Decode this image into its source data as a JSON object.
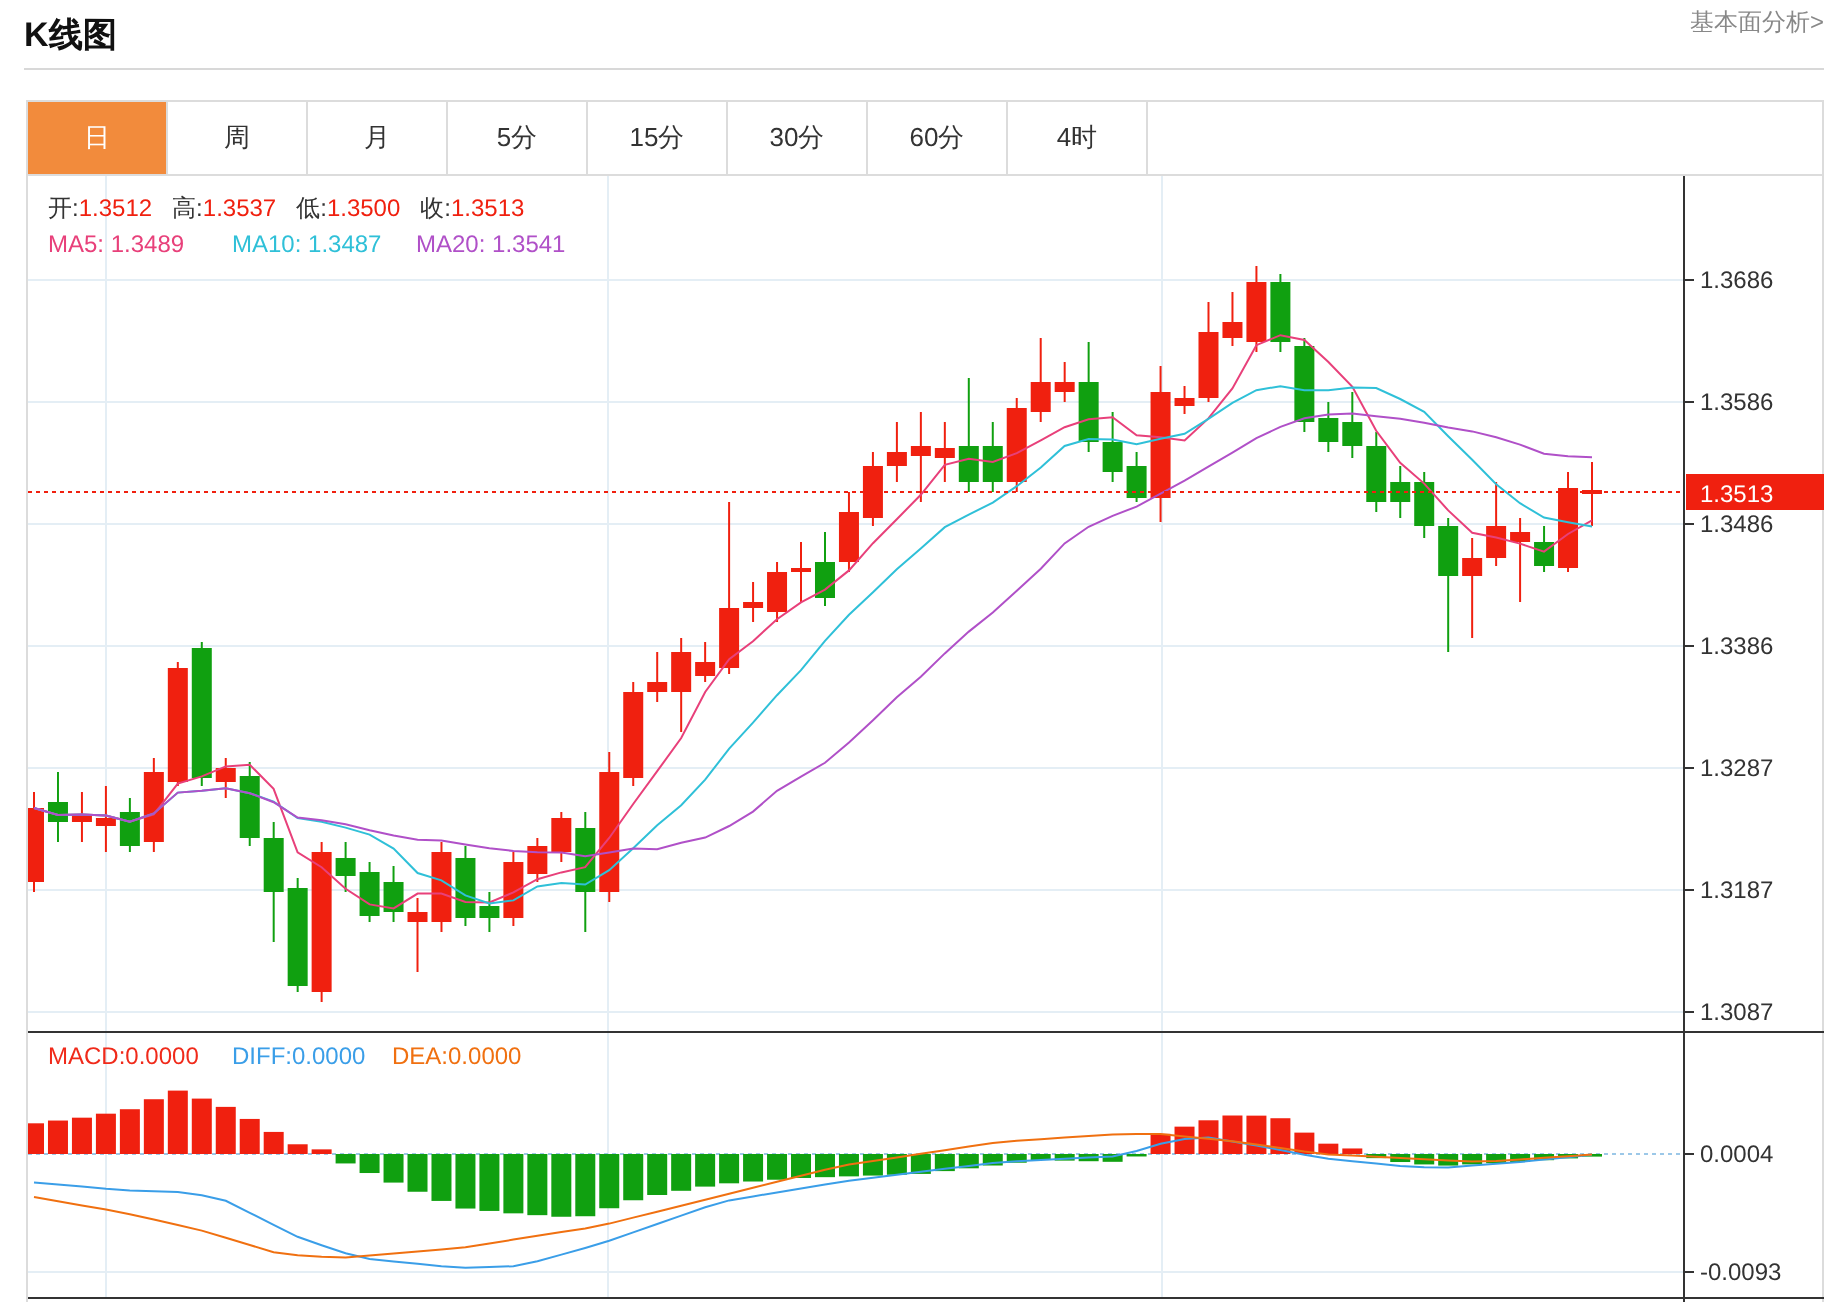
{
  "header": {
    "title": "K线图",
    "link": "基本面分析>"
  },
  "tabs": [
    {
      "label": "日",
      "selected": true
    },
    {
      "label": "周",
      "selected": false
    },
    {
      "label": "月",
      "selected": false
    },
    {
      "label": "5分",
      "selected": false
    },
    {
      "label": "15分",
      "selected": false
    },
    {
      "label": "30分",
      "selected": false
    },
    {
      "label": "60分",
      "selected": false
    },
    {
      "label": "4时",
      "selected": false
    }
  ],
  "legend": {
    "ohlc": [
      {
        "label": "开:",
        "value": "1.3512"
      },
      {
        "label": "高:",
        "value": "1.3537"
      },
      {
        "label": "低:",
        "value": "1.3500"
      },
      {
        "label": "收:",
        "value": "1.3513"
      }
    ],
    "ma": [
      {
        "text": "MA5: 1.3489",
        "color": "#e8407a"
      },
      {
        "text": "MA10: 1.3487",
        "color": "#2fc0d8"
      },
      {
        "text": "MA20: 1.3541",
        "color": "#b050c8"
      }
    ]
  },
  "price_axis": {
    "labels": [
      "1.3686",
      "1.3586",
      "1.3486",
      "1.3386",
      "1.3287",
      "1.3187",
      "1.3087"
    ],
    "current": "1.3513"
  },
  "macd_legend": [
    {
      "text": "MACD:0.0000",
      "color": "#f02a1a"
    },
    {
      "text": "DIFF:0.0000",
      "color": "#3a9ee8"
    },
    {
      "text": "DEA:0.0000",
      "color": "#f07010"
    }
  ],
  "macd_axis": {
    "labels": [
      "0.0004",
      "-0.0093"
    ]
  }
}
